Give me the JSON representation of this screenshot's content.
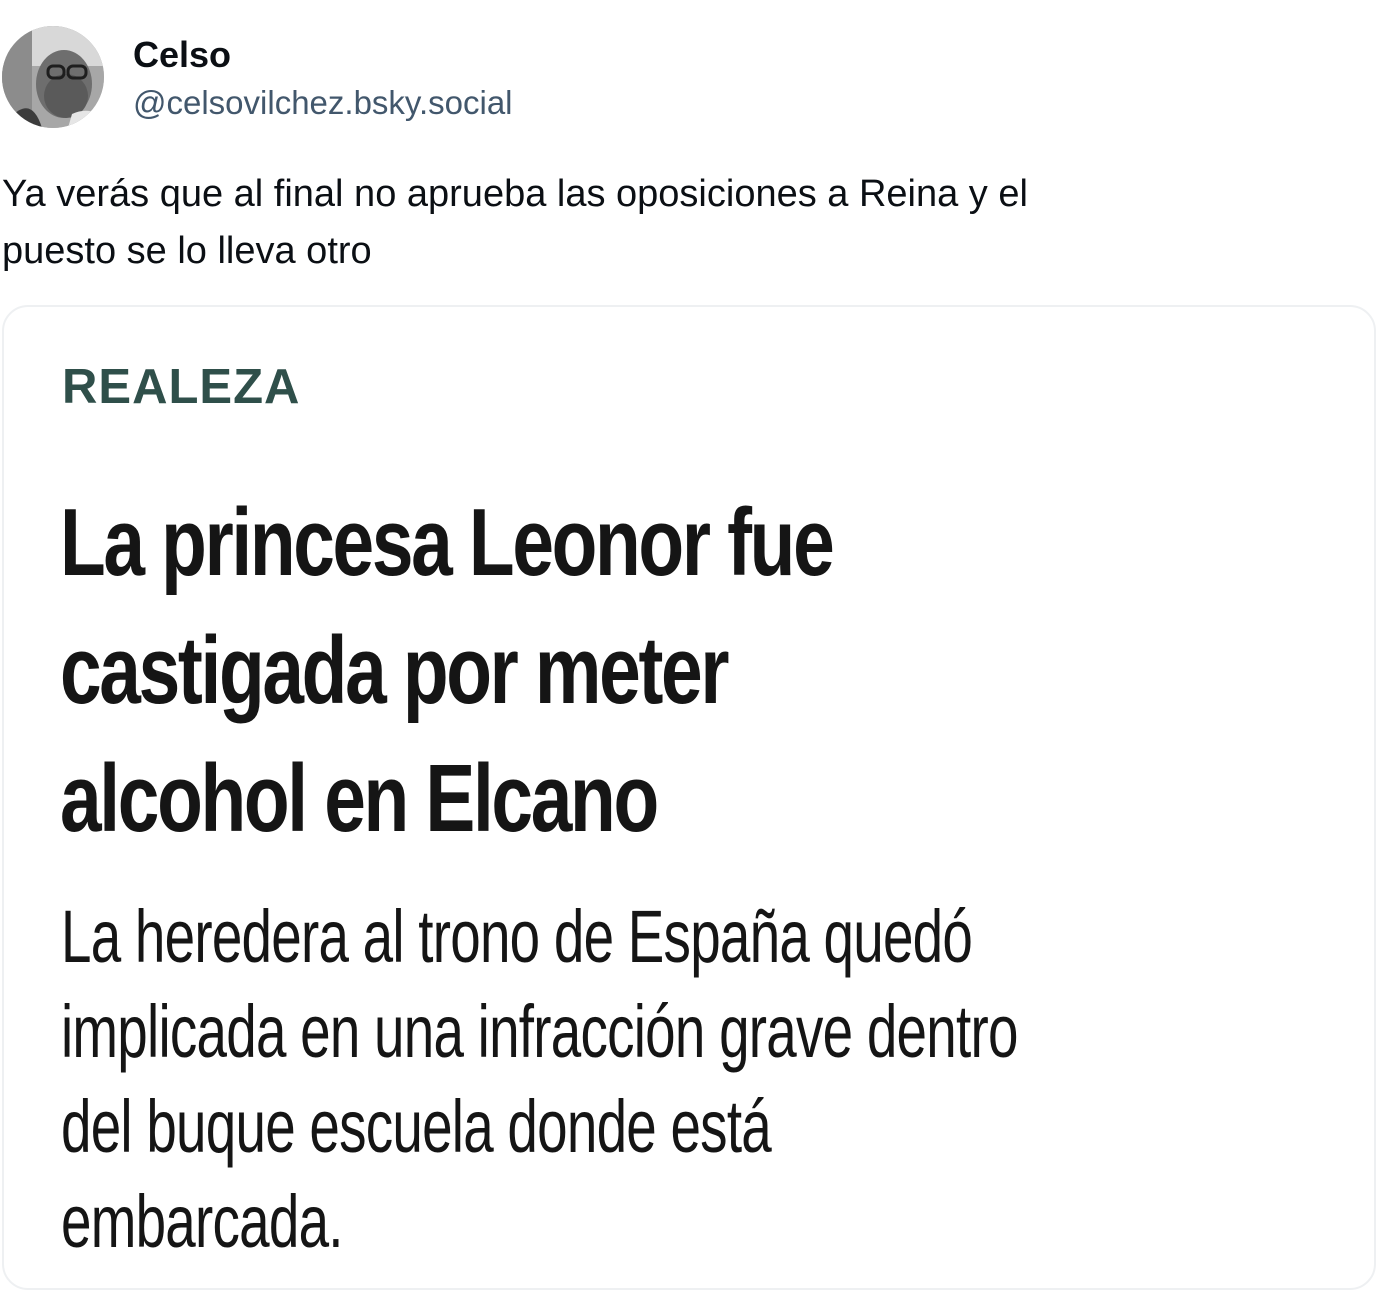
{
  "author": {
    "display_name": "Celso",
    "handle": "@celsovilchez.bsky.social",
    "avatar_icon": "user-photo-avatar"
  },
  "post": {
    "text_lines": [
      "Ya verás que al final no aprueba las oposiciones a Reina y el",
      "puesto se lo lleva otro"
    ]
  },
  "embed": {
    "section": "REALEZA",
    "headline_lines": [
      "La princesa Leonor fue",
      "castigada por meter",
      "alcohol en Elcano"
    ],
    "subhead_lines": [
      "La heredera al trono de España quedó",
      "implicada en una infracción grave dentro",
      "del buque escuela donde está",
      "embarcada."
    ],
    "section_color": "#2f4f4a"
  }
}
